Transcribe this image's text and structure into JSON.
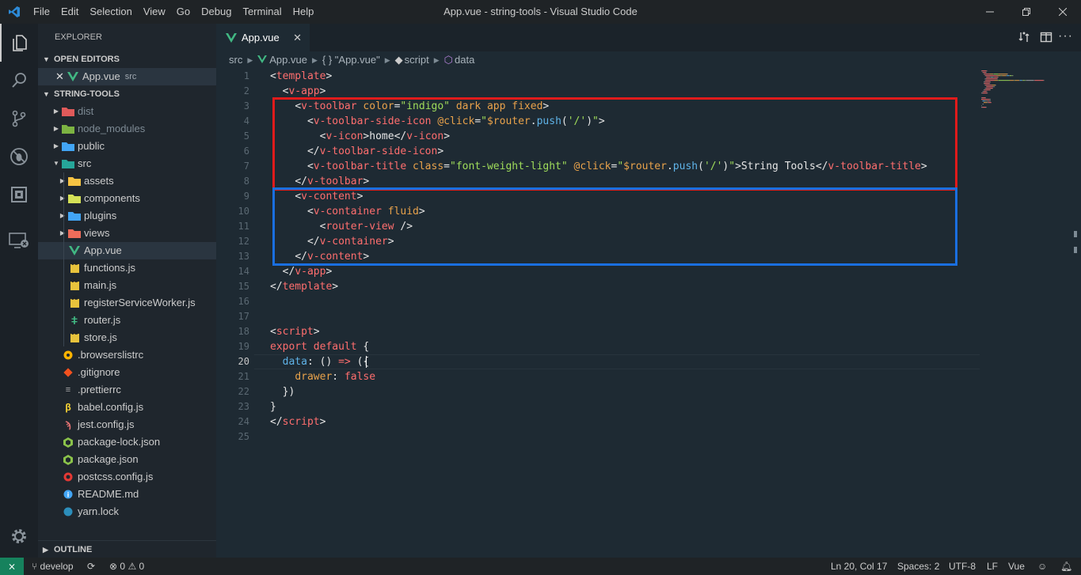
{
  "window": {
    "title": "App.vue - string-tools - Visual Studio Code",
    "menu": [
      "File",
      "Edit",
      "Selection",
      "View",
      "Go",
      "Debug",
      "Terminal",
      "Help"
    ]
  },
  "activity_bar": [
    "files-icon",
    "search-icon",
    "source-control-icon",
    "debug-icon",
    "extensions-icon",
    "remote-explorer-icon",
    "settings-gear-icon"
  ],
  "explorer": {
    "header": "EXPLORER",
    "open_editors_label": "OPEN EDITORS",
    "open_editor": {
      "name": "App.vue",
      "dir": "src"
    },
    "project_label": "STRING-TOOLS",
    "tree": [
      {
        "name": "dist",
        "type": "folder",
        "depth": 0,
        "dim": true,
        "color": "#e05a5a"
      },
      {
        "name": "node_modules",
        "type": "folder",
        "depth": 0,
        "dim": true,
        "color": "#7cb342"
      },
      {
        "name": "public",
        "type": "folder",
        "depth": 0,
        "color": "#42a5f5"
      },
      {
        "name": "src",
        "type": "folder-open",
        "depth": 0,
        "color": "#26a69a"
      },
      {
        "name": "assets",
        "type": "folder",
        "depth": 1,
        "color": "#f6c343"
      },
      {
        "name": "components",
        "type": "folder",
        "depth": 1,
        "color": "#d4e157"
      },
      {
        "name": "plugins",
        "type": "folder",
        "depth": 1,
        "color": "#42a5f5"
      },
      {
        "name": "views",
        "type": "folder",
        "depth": 1,
        "color": "#ef6c5a"
      },
      {
        "name": "App.vue",
        "type": "vue",
        "depth": 1,
        "selected": true
      },
      {
        "name": "functions.js",
        "type": "js",
        "depth": 1
      },
      {
        "name": "main.js",
        "type": "js",
        "depth": 1
      },
      {
        "name": "registerServiceWorker.js",
        "type": "js",
        "depth": 1
      },
      {
        "name": "router.js",
        "type": "router",
        "depth": 1
      },
      {
        "name": "store.js",
        "type": "js",
        "depth": 1
      },
      {
        "name": ".browserslistrc",
        "type": "browsers",
        "depth": 0
      },
      {
        "name": ".gitignore",
        "type": "git",
        "depth": 0
      },
      {
        "name": ".prettierrc",
        "type": "prettier",
        "depth": 0
      },
      {
        "name": "babel.config.js",
        "type": "babel",
        "depth": 0
      },
      {
        "name": "jest.config.js",
        "type": "jest",
        "depth": 0
      },
      {
        "name": "package-lock.json",
        "type": "node",
        "depth": 0
      },
      {
        "name": "package.json",
        "type": "node",
        "depth": 0
      },
      {
        "name": "postcss.config.js",
        "type": "postcss",
        "depth": 0
      },
      {
        "name": "README.md",
        "type": "info",
        "depth": 0
      },
      {
        "name": "yarn.lock",
        "type": "yarn",
        "depth": 0
      }
    ],
    "outline_label": "OUTLINE"
  },
  "editor": {
    "tab_label": "App.vue",
    "breadcrumb": [
      "src",
      "App.vue",
      "{ } \"App.vue\"",
      "script",
      "data"
    ],
    "current_line": 20,
    "lines": [
      [
        [
          "t-br",
          "<"
        ],
        [
          "t-tag",
          "template"
        ],
        [
          "t-br",
          ">"
        ]
      ],
      [
        [
          "",
          "  "
        ],
        [
          "t-br",
          "<"
        ],
        [
          "t-tag",
          "v-app"
        ],
        [
          "t-br",
          ">"
        ]
      ],
      [
        [
          "",
          "    "
        ],
        [
          "t-br",
          "<"
        ],
        [
          "t-tag",
          "v-toolbar"
        ],
        [
          "t-attr",
          " color"
        ],
        [
          "t-br",
          "="
        ],
        [
          "t-str",
          "\"indigo\""
        ],
        [
          "t-attr",
          " dark app fixed"
        ],
        [
          "t-br",
          ">"
        ]
      ],
      [
        [
          "",
          "      "
        ],
        [
          "t-br",
          "<"
        ],
        [
          "t-tag",
          "v-toolbar-side-icon"
        ],
        [
          "t-attr",
          " @click"
        ],
        [
          "t-br",
          "="
        ],
        [
          "t-str",
          "\""
        ],
        [
          "t-var",
          "$router"
        ],
        [
          "t-br",
          "."
        ],
        [
          "t-fn",
          "push"
        ],
        [
          "t-br",
          "("
        ],
        [
          "t-str",
          "'/'"
        ],
        [
          "t-br",
          ")"
        ],
        [
          "t-str",
          "\""
        ],
        [
          "t-br",
          ">"
        ]
      ],
      [
        [
          "",
          "        "
        ],
        [
          "t-br",
          "<"
        ],
        [
          "t-tag",
          "v-icon"
        ],
        [
          "t-br",
          ">"
        ],
        [
          "t-txt",
          "home"
        ],
        [
          "t-br",
          "</"
        ],
        [
          "t-tag",
          "v-icon"
        ],
        [
          "t-br",
          ">"
        ]
      ],
      [
        [
          "",
          "      "
        ],
        [
          "t-br",
          "</"
        ],
        [
          "t-tag",
          "v-toolbar-side-icon"
        ],
        [
          "t-br",
          ">"
        ]
      ],
      [
        [
          "",
          "      "
        ],
        [
          "t-br",
          "<"
        ],
        [
          "t-tag",
          "v-toolbar-title"
        ],
        [
          "t-attr",
          " class"
        ],
        [
          "t-br",
          "="
        ],
        [
          "t-str",
          "\"font-weight-light\""
        ],
        [
          "t-attr",
          " @click"
        ],
        [
          "t-br",
          "="
        ],
        [
          "t-str",
          "\""
        ],
        [
          "t-var",
          "$router"
        ],
        [
          "t-br",
          "."
        ],
        [
          "t-fn",
          "push"
        ],
        [
          "t-br",
          "("
        ],
        [
          "t-str",
          "'/'"
        ],
        [
          "t-br",
          ")"
        ],
        [
          "t-str",
          "\""
        ],
        [
          "t-br",
          ">"
        ],
        [
          "t-txt",
          "String Tools"
        ],
        [
          "t-br",
          "</"
        ],
        [
          "t-tag",
          "v-toolbar-title"
        ],
        [
          "t-br",
          ">"
        ]
      ],
      [
        [
          "",
          "    "
        ],
        [
          "t-br",
          "</"
        ],
        [
          "t-tag",
          "v-toolbar"
        ],
        [
          "t-br",
          ">"
        ]
      ],
      [
        [
          "",
          "    "
        ],
        [
          "t-br",
          "<"
        ],
        [
          "t-tag",
          "v-content"
        ],
        [
          "t-br",
          ">"
        ]
      ],
      [
        [
          "",
          "      "
        ],
        [
          "t-br",
          "<"
        ],
        [
          "t-tag",
          "v-container"
        ],
        [
          "t-attr",
          " fluid"
        ],
        [
          "t-br",
          ">"
        ]
      ],
      [
        [
          "",
          "        "
        ],
        [
          "t-br",
          "<"
        ],
        [
          "t-tag",
          "router-view"
        ],
        [
          "t-br",
          " />"
        ]
      ],
      [
        [
          "",
          "      "
        ],
        [
          "t-br",
          "</"
        ],
        [
          "t-tag",
          "v-container"
        ],
        [
          "t-br",
          ">"
        ]
      ],
      [
        [
          "",
          "    "
        ],
        [
          "t-br",
          "</"
        ],
        [
          "t-tag",
          "v-content"
        ],
        [
          "t-br",
          ">"
        ]
      ],
      [
        [
          "",
          "  "
        ],
        [
          "t-br",
          "</"
        ],
        [
          "t-tag",
          "v-app"
        ],
        [
          "t-br",
          ">"
        ]
      ],
      [
        [
          "t-br",
          "</"
        ],
        [
          "t-tag",
          "template"
        ],
        [
          "t-br",
          ">"
        ]
      ],
      [],
      [],
      [
        [
          "t-br",
          "<"
        ],
        [
          "t-tag",
          "script"
        ],
        [
          "t-br",
          ">"
        ]
      ],
      [
        [
          "t-kw",
          "export default"
        ],
        [
          "t-br",
          " {"
        ]
      ],
      [
        [
          "",
          "  "
        ],
        [
          "t-prop",
          "data"
        ],
        [
          "t-br",
          ": () "
        ],
        [
          "t-kw",
          "=>"
        ],
        [
          "t-br",
          " ({"
        ]
      ],
      [
        [
          "",
          "    "
        ],
        [
          "t-attr",
          "drawer"
        ],
        [
          "t-br",
          ": "
        ],
        [
          "t-bool",
          "false"
        ]
      ],
      [
        [
          "",
          "  "
        ],
        [
          "t-br",
          "})"
        ]
      ],
      [
        [
          "t-br",
          "}"
        ]
      ],
      [
        [
          "t-br",
          "</"
        ],
        [
          "t-tag",
          "script"
        ],
        [
          "t-br",
          ">"
        ]
      ],
      []
    ],
    "annotations": [
      {
        "color": "#e01b1b",
        "from_line": 3,
        "to_line": 8
      },
      {
        "color": "#1a6fe0",
        "from_line": 9,
        "to_line": 13
      }
    ]
  },
  "status": {
    "branch": "develop",
    "errors": "0",
    "warnings": "0",
    "position": "Ln 20, Col 17",
    "spaces": "Spaces: 2",
    "encoding": "UTF-8",
    "eol": "LF",
    "language": "Vue",
    "accent": "#1f2326"
  }
}
